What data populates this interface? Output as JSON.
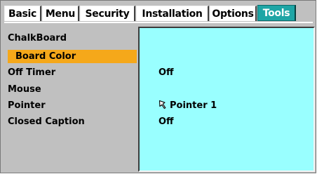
{
  "tabs": [
    {
      "label": "Basic",
      "active": false
    },
    {
      "label": "Menu",
      "active": false
    },
    {
      "label": "Security",
      "active": false
    },
    {
      "label": "Installation",
      "active": false
    },
    {
      "label": "Options",
      "active": false
    },
    {
      "label": "Tools",
      "active": true
    }
  ],
  "menu": {
    "items": [
      {
        "label": "ChalkBoard",
        "selected": false
      },
      {
        "label": "Board Color",
        "selected": true
      },
      {
        "label": "Off Timer",
        "selected": false
      },
      {
        "label": "Mouse",
        "selected": false
      },
      {
        "label": "Pointer",
        "selected": false
      },
      {
        "label": "Closed Caption",
        "selected": false
      }
    ]
  },
  "values": {
    "off_timer": "Off",
    "pointer": "Pointer 1",
    "pointer_icon": "arrow-cursor-icon",
    "closed_caption": "Off"
  },
  "colors": {
    "active_tab": "#1ea5a5",
    "selection": "#f5a81a",
    "panel": "#99ffff",
    "window": "#c0c0c0"
  }
}
